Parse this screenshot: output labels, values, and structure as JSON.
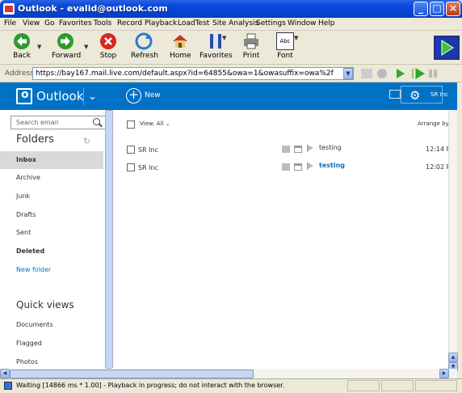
{
  "window": {
    "title": "Outlook - evalid@outlook.com",
    "minimize_glyph": "_",
    "maximize_glyph": "□",
    "close_glyph": "×"
  },
  "menu": [
    "File",
    "View",
    "Go",
    "Favorites",
    "Tools",
    "Record",
    "Playback",
    "LoadTest",
    "Site Analysis",
    "Settings",
    "Window",
    "Help"
  ],
  "toolbar": {
    "back": "Back",
    "forward": "Forward",
    "stop": "Stop",
    "refresh": "Refresh",
    "home": "Home",
    "favorites": "Favorites",
    "print": "Print",
    "font": "Font",
    "font_glyph": "Abc"
  },
  "address": {
    "label": "Address",
    "url": "https://bay167.mail.live.com/default.aspx?id=64855&owa=1&owasuffix=owa%2f"
  },
  "outlook": {
    "brand": "Outlook",
    "new_label": "New",
    "user": "SR Inc",
    "search_placeholder": "Search email",
    "folders_title": "Folders",
    "folders": [
      "Inbox",
      "Archive",
      "Junk",
      "Drafts",
      "Sent",
      "Deleted"
    ],
    "new_folder": "New folder",
    "quick_views_title": "Quick views",
    "quick_views": [
      "Documents",
      "Flagged",
      "Photos"
    ],
    "view_all": "View: All",
    "arrange_by": "Arrange by",
    "messages": [
      {
        "from": "SR Inc",
        "subject": "testing",
        "time": "12:14 P",
        "unread": false
      },
      {
        "from": "SR Inc",
        "subject": "testing",
        "time": "12:02 P",
        "unread": true
      }
    ]
  },
  "status": {
    "text": "Waiting [14866 ms * 1.00] - Playback in progress; do not interact with the browser."
  },
  "colors": {
    "outlook_blue": "#0072c6",
    "xp_title_blue": "#0a4adf",
    "selected_folder_bg": "#d9d9d9",
    "unread_subject": "#0072c6"
  }
}
